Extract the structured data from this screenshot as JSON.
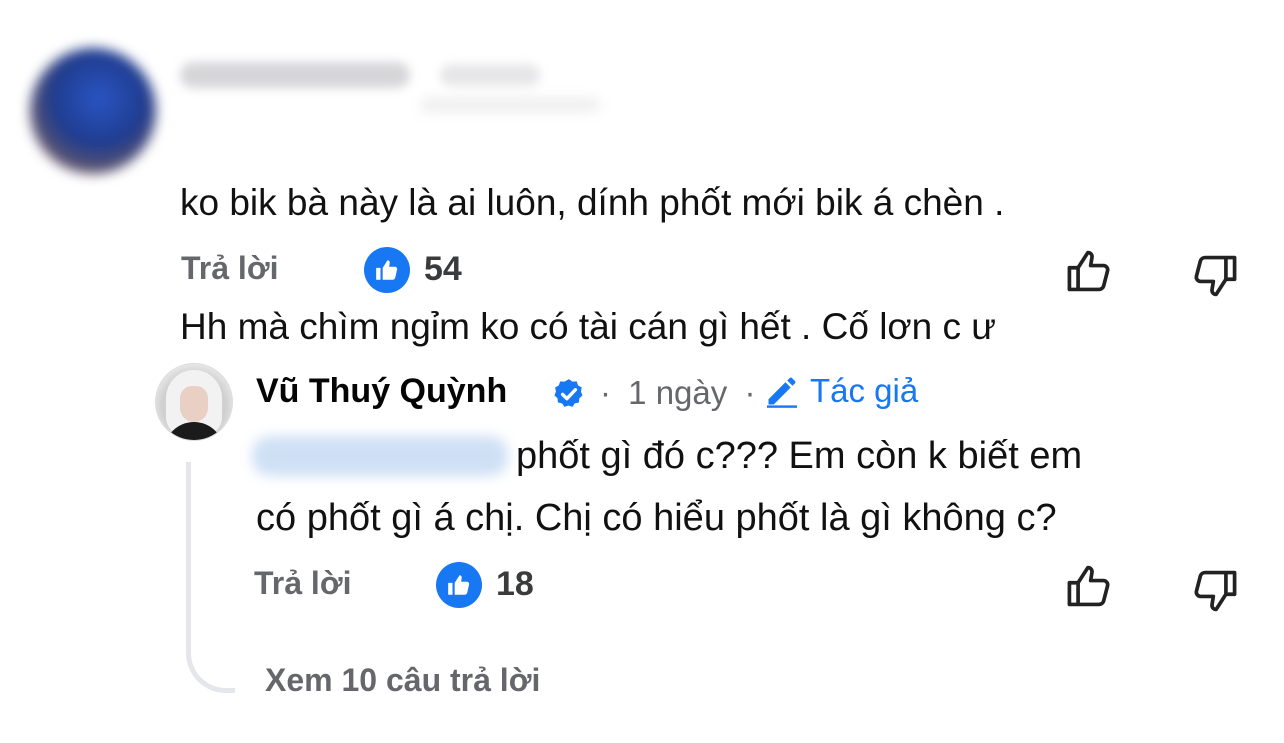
{
  "comment1": {
    "text_line1": "ko bik bà này là ai luôn, dính phốt mới bik á chèn .",
    "text_line2": "Hh mà chìm ngỉm ko có tài cán gì hết . Cố lơn c ư",
    "reply_label": "Trả lời",
    "like_count": "54"
  },
  "reply1": {
    "author": "Vũ Thuý Quỳnh",
    "separator": "·",
    "time": "1 ngày",
    "author_badge_label": "Tác giả",
    "text_line1": "phốt gì đó c??? Em còn k biết em",
    "text_line2": "có phốt gì á chị. Chị có hiểu phốt là gì không c?",
    "reply_label": "Trả lời",
    "like_count": "18"
  },
  "view_more_replies": "Xem 10 câu trả lời",
  "colors": {
    "accent": "#1877f2",
    "muted": "#65676b"
  },
  "icons": [
    "thumbs-up-icon",
    "thumbs-down-icon",
    "verified-badge-icon",
    "pencil-icon"
  ]
}
